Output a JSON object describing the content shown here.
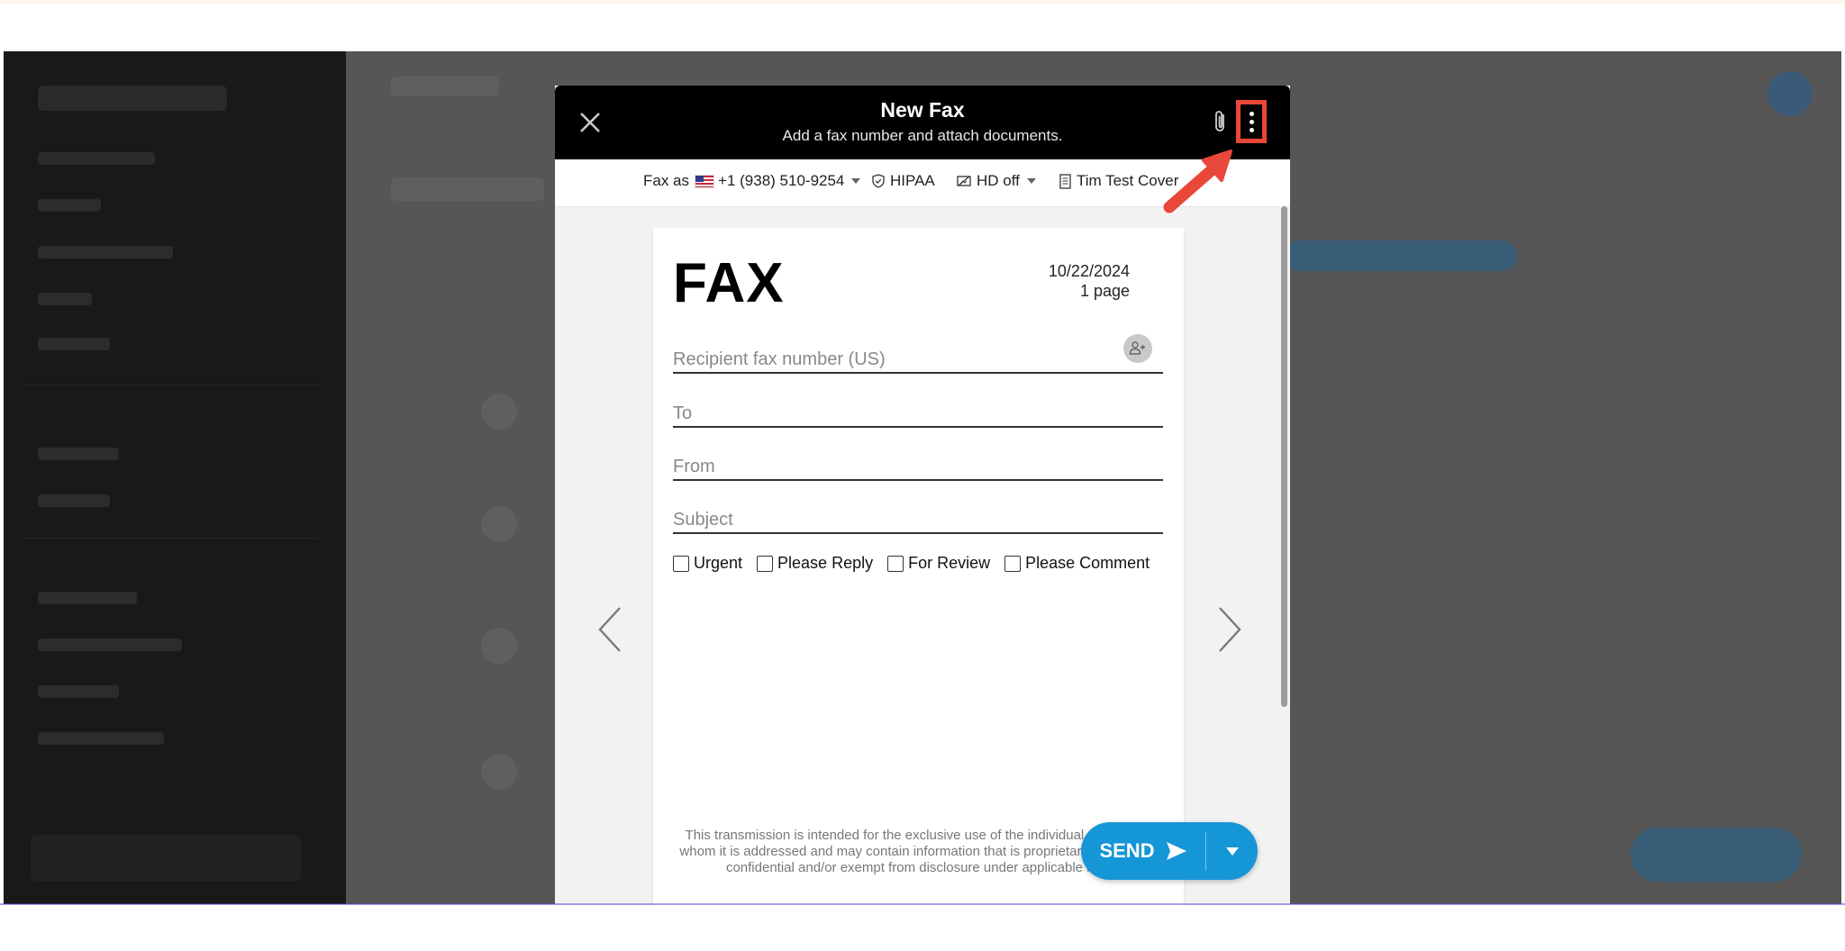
{
  "modal": {
    "title": "New Fax",
    "subtitle": "Add a fax number and attach documents."
  },
  "options": {
    "fax_as_label": "Fax as",
    "fax_number": "+1 (938) 510-9254",
    "hipaa_label": "HIPAA",
    "hd_label": "HD off",
    "cover_label": "Tim Test Cover"
  },
  "page": {
    "heading": "FAX",
    "date": "10/22/2024",
    "page_count": "1 page",
    "fields": {
      "recipient_placeholder": "Recipient fax number (US)",
      "to_placeholder": "To",
      "from_placeholder": "From",
      "subject_placeholder": "Subject"
    },
    "checkboxes": [
      "Urgent",
      "Please Reply",
      "For Review",
      "Please Comment"
    ],
    "disclaimer": "This transmission is intended for the exclusive use of the individual or entity to whom it is addressed and may contain information that is proprietary, privileged, confidential and/or exempt from disclosure under applicable law."
  },
  "actions": {
    "send_label": "SEND"
  },
  "colors": {
    "accent_blue": "#1596d6",
    "highlight_red": "#e8473a",
    "header_black": "#000000"
  },
  "icons": [
    "close-icon",
    "paperclip-icon",
    "more-vertical-icon",
    "flag-us-icon",
    "shield-icon",
    "hd-icon",
    "cover-page-icon",
    "add-contact-icon",
    "chevron-left-icon",
    "chevron-right-icon",
    "send-icon",
    "caret-down-icon",
    "pointer-arrow-icon"
  ]
}
